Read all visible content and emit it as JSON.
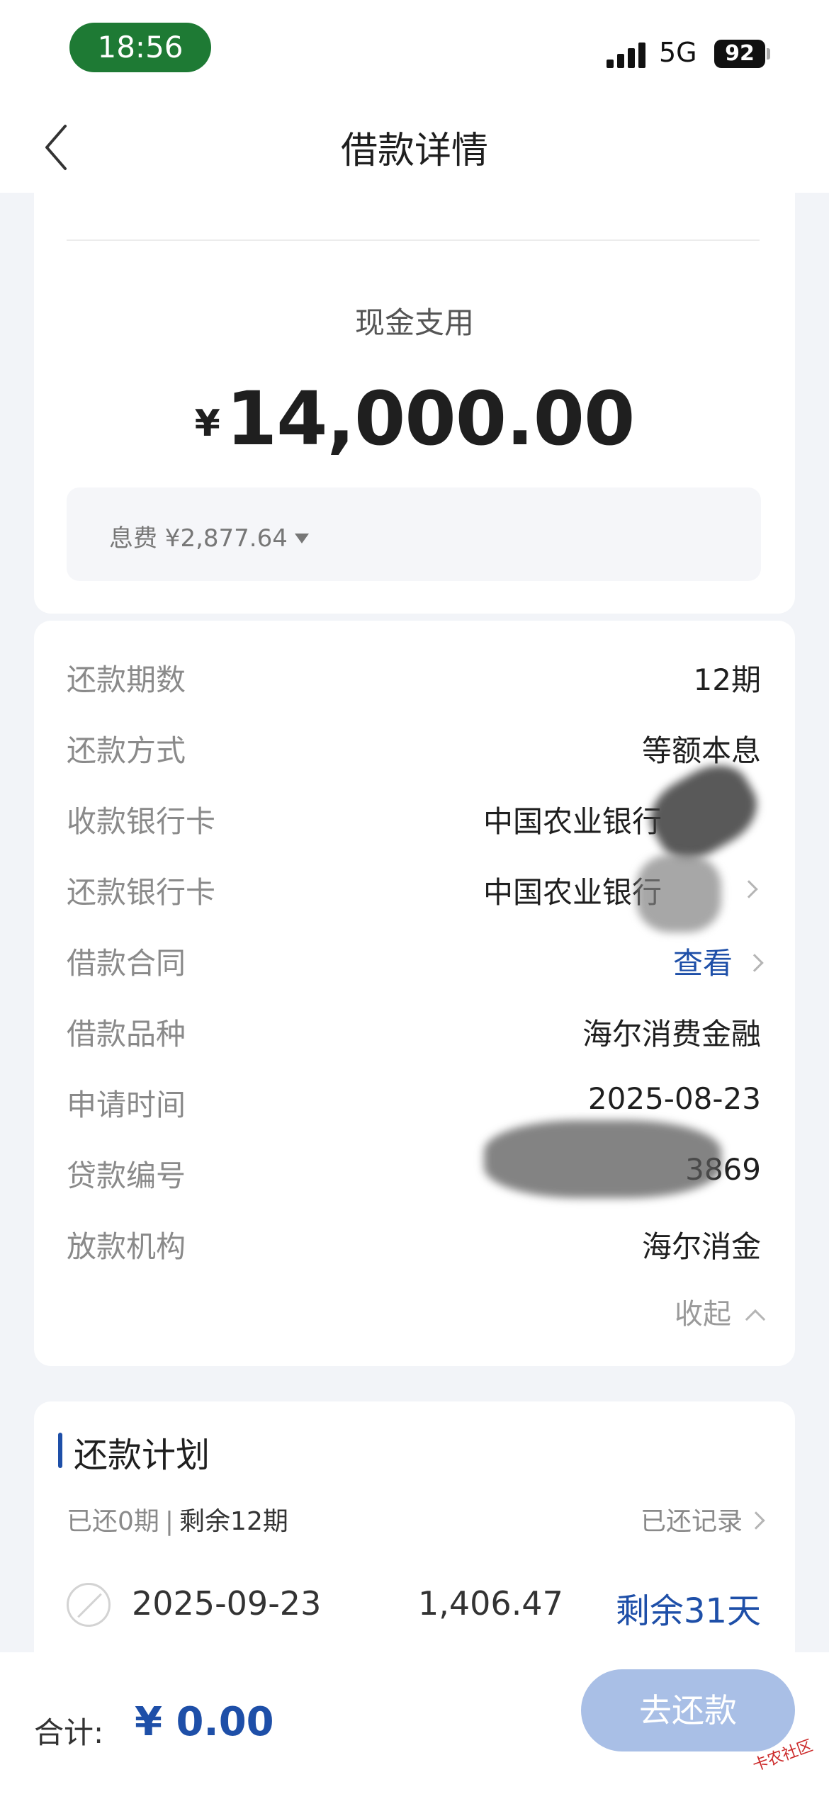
{
  "status_bar": {
    "time": "18:56",
    "network": "5G",
    "battery": "92"
  },
  "nav": {
    "title": "借款详情"
  },
  "loan": {
    "usage_label": "现金支用",
    "currency_symbol": "¥",
    "amount": "14,000.00",
    "fee_text": "息费 ¥2,877.64"
  },
  "details": {
    "rows": [
      {
        "label": "还款期数",
        "value": "12期"
      },
      {
        "label": "还款方式",
        "value": "等额本息"
      },
      {
        "label": "收款银行卡",
        "value": "中国农业银行"
      },
      {
        "label": "还款银行卡",
        "value": "中国农业银行"
      },
      {
        "label": "借款合同",
        "value": "查看"
      },
      {
        "label": "借款品种",
        "value": "海尔消费金融"
      },
      {
        "label": "申请时间",
        "value": "2025-08-23"
      },
      {
        "label": "贷款编号",
        "value": "3869"
      },
      {
        "label": "放款机构",
        "value": "海尔消金"
      }
    ],
    "collapse_label": "收起"
  },
  "plan": {
    "title": "还款计划",
    "repaid": "已还0期",
    "separator": "|",
    "remaining": "剩余12期",
    "history_link": "已还记录",
    "installments": [
      {
        "date": "2025-09-23",
        "amount": "1,406.47",
        "remaining_days": "剩余31天"
      }
    ]
  },
  "footer": {
    "total_label": "合计:",
    "total_amount": "¥ 0.00",
    "pay_button": "去还款"
  },
  "watermark": "卡农社区",
  "colors": {
    "accent": "#1e4fa8",
    "button_disabled": "#a9bfe6",
    "time_pill": "#1e7a34",
    "background": "#f2f4f8"
  }
}
